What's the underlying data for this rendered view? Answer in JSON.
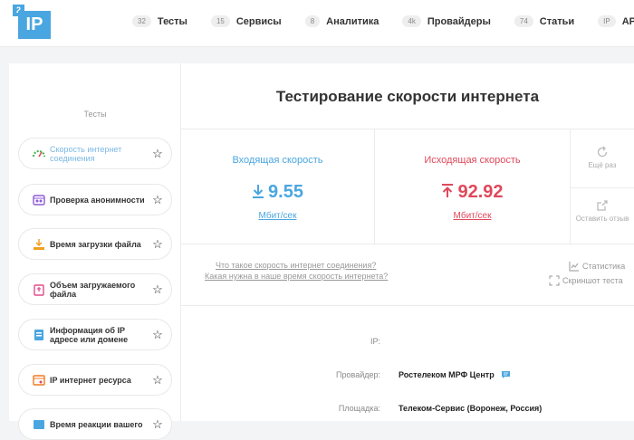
{
  "logo": {
    "small": "2",
    "big": "IP"
  },
  "nav": [
    {
      "badge": "32",
      "label": "Тесты"
    },
    {
      "badge": "15",
      "label": "Сервисы"
    },
    {
      "badge": "8",
      "label": "Аналитика"
    },
    {
      "badge": "4k",
      "label": "Провайдеры"
    },
    {
      "badge": "74",
      "label": "Статьи"
    },
    {
      "badge": "IP",
      "label": "API"
    }
  ],
  "sidebar": {
    "title": "Тесты",
    "items": [
      {
        "label": "Скорость интернет соединения",
        "icon": "speedometer-icon"
      },
      {
        "label": "Проверка анонимности",
        "icon": "incognito-icon"
      },
      {
        "label": "Время загрузки файла",
        "icon": "download-tray-icon"
      },
      {
        "label": "Объем загружаемого файла",
        "icon": "file-size-icon"
      },
      {
        "label": "Информация об IP адресе или домене",
        "icon": "ip-info-icon"
      },
      {
        "label": "IP интернет ресурса",
        "icon": "web-resource-icon"
      },
      {
        "label": "Время реакции вашего",
        "icon": "reaction-icon"
      }
    ]
  },
  "main": {
    "title": "Тестирование скорости интернета",
    "download": {
      "label": "Входящая скорость",
      "value": "9.55",
      "unit": "Мбит/сек"
    },
    "upload": {
      "label": "Исходящая скорость",
      "value": "92.92",
      "unit": "Мбит/сек"
    },
    "actions": {
      "again": "Ещё раз",
      "feedback": "Оставить отзыв"
    },
    "links": {
      "q1": "Что такое скорость интернет соединения?",
      "q2": "Какая нужна в наше время скорость интернета?"
    },
    "tools": {
      "stats": "Статистика",
      "screenshot": "Скриншот теста"
    },
    "info": [
      {
        "key": "IP:",
        "value": ""
      },
      {
        "key": "Провайдер:",
        "value": "Ростелеком МРФ Центр"
      },
      {
        "key": "Площадка:",
        "value": "Телеком-Сервис (Воронеж, Россия)"
      }
    ]
  },
  "colors": {
    "accent_blue": "#4aa6e0",
    "accent_red": "#e0485a"
  }
}
